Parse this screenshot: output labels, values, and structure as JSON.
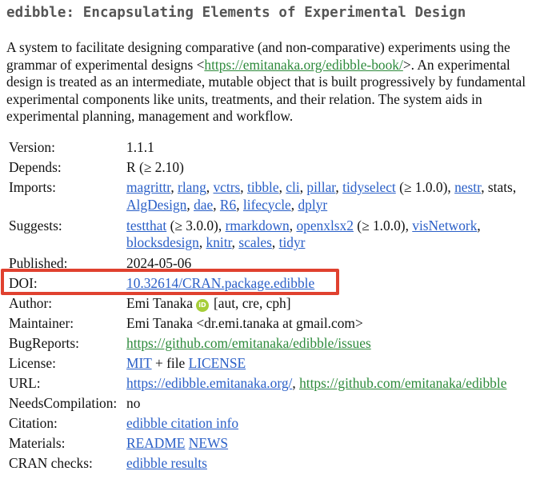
{
  "title": "edibble: Encapsulating Elements of Experimental Design",
  "description": {
    "part1": "A system to facilitate designing comparative (and non-comparative) experiments using the",
    "part2_pre": "grammar of experimental designs <",
    "book_url": "https://emitanaka.org/edibble-book/",
    "part2_post": ">. An experimental",
    "part3": "design is treated as an intermediate, mutable object that is built progressively by fundamental",
    "part4": "experimental components like units, treatments, and their relation. The system aids in",
    "part5": "experimental planning, management and workflow."
  },
  "fields": {
    "version": {
      "label": "Version:",
      "value": "1.1.1"
    },
    "depends": {
      "label": "Depends:",
      "value": "R (≥ 2.10)"
    },
    "imports": {
      "label": "Imports:",
      "items": [
        "magrittr",
        "rlang",
        "vctrs",
        "tibble",
        "cli",
        "pillar",
        "tidyselect",
        "nestr",
        "AlgDesign",
        "dae",
        "R6",
        "lifecycle",
        "dplyr"
      ],
      "tidyselect_version": "(≥ 1.0.0)",
      "stats": "stats"
    },
    "suggests": {
      "label": "Suggests:",
      "items": [
        "testthat",
        "rmarkdown",
        "openxlsx2",
        "visNetwork",
        "blocksdesign",
        "knitr",
        "scales",
        "tidyr"
      ],
      "testthat_version": "(≥ 3.0.0)",
      "openxlsx2_version": "(≥ 1.0.0)"
    },
    "published": {
      "label": "Published:",
      "value": "2024-05-06"
    },
    "doi": {
      "label": "DOI:",
      "value": "10.32614/CRAN.package.edibble"
    },
    "author": {
      "label": "Author:",
      "name": "Emi Tanaka",
      "roles": "[aut, cre, cph]",
      "orcid_icon": "iD"
    },
    "maintainer": {
      "label": "Maintainer:",
      "value": "Emi Tanaka <dr.emi.tanaka at gmail.com>"
    },
    "bugreports": {
      "label": "BugReports:",
      "value": "https://github.com/emitanaka/edibble/issues"
    },
    "license": {
      "label": "License:",
      "mit": "MIT",
      "plus": "+ file",
      "license_link": "LICENSE"
    },
    "url": {
      "label": "URL:",
      "url1": "https://edibble.emitanaka.org/",
      "url2": "https://github.com/emitanaka/edibble"
    },
    "needs_compilation": {
      "label": "NeedsCompilation:",
      "value": "no"
    },
    "citation": {
      "label": "Citation:",
      "value": "edibble citation info"
    },
    "materials": {
      "label": "Materials:",
      "readme": "README",
      "news": "NEWS"
    },
    "cran_checks": {
      "label": "CRAN checks:",
      "value": "edibble results"
    }
  },
  "colors": {
    "link": "#2a5fc7",
    "external_link": "#2d8a3b",
    "highlight": "#e0412f",
    "title": "#555555",
    "orcid": "#a6ce39"
  }
}
